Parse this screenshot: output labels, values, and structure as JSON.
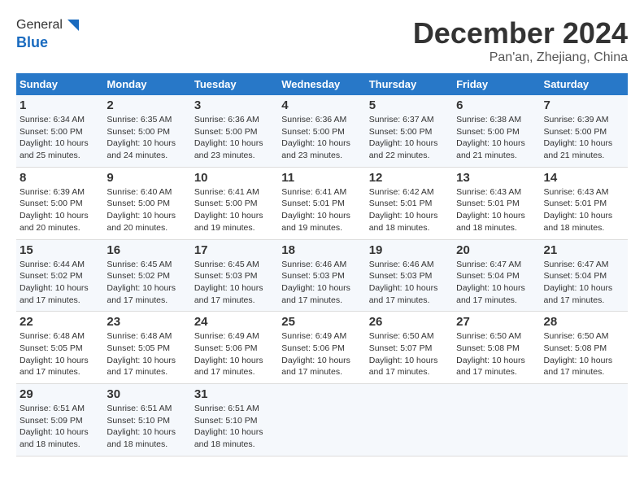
{
  "header": {
    "logo_line1": "General",
    "logo_line2": "Blue",
    "month": "December 2024",
    "location": "Pan'an, Zhejiang, China"
  },
  "days_of_week": [
    "Sunday",
    "Monday",
    "Tuesday",
    "Wednesday",
    "Thursday",
    "Friday",
    "Saturday"
  ],
  "weeks": [
    [
      {
        "day": "1",
        "info": "Sunrise: 6:34 AM\nSunset: 5:00 PM\nDaylight: 10 hours\nand 25 minutes."
      },
      {
        "day": "2",
        "info": "Sunrise: 6:35 AM\nSunset: 5:00 PM\nDaylight: 10 hours\nand 24 minutes."
      },
      {
        "day": "3",
        "info": "Sunrise: 6:36 AM\nSunset: 5:00 PM\nDaylight: 10 hours\nand 23 minutes."
      },
      {
        "day": "4",
        "info": "Sunrise: 6:36 AM\nSunset: 5:00 PM\nDaylight: 10 hours\nand 23 minutes."
      },
      {
        "day": "5",
        "info": "Sunrise: 6:37 AM\nSunset: 5:00 PM\nDaylight: 10 hours\nand 22 minutes."
      },
      {
        "day": "6",
        "info": "Sunrise: 6:38 AM\nSunset: 5:00 PM\nDaylight: 10 hours\nand 21 minutes."
      },
      {
        "day": "7",
        "info": "Sunrise: 6:39 AM\nSunset: 5:00 PM\nDaylight: 10 hours\nand 21 minutes."
      }
    ],
    [
      {
        "day": "8",
        "info": "Sunrise: 6:39 AM\nSunset: 5:00 PM\nDaylight: 10 hours\nand 20 minutes."
      },
      {
        "day": "9",
        "info": "Sunrise: 6:40 AM\nSunset: 5:00 PM\nDaylight: 10 hours\nand 20 minutes."
      },
      {
        "day": "10",
        "info": "Sunrise: 6:41 AM\nSunset: 5:00 PM\nDaylight: 10 hours\nand 19 minutes."
      },
      {
        "day": "11",
        "info": "Sunrise: 6:41 AM\nSunset: 5:01 PM\nDaylight: 10 hours\nand 19 minutes."
      },
      {
        "day": "12",
        "info": "Sunrise: 6:42 AM\nSunset: 5:01 PM\nDaylight: 10 hours\nand 18 minutes."
      },
      {
        "day": "13",
        "info": "Sunrise: 6:43 AM\nSunset: 5:01 PM\nDaylight: 10 hours\nand 18 minutes."
      },
      {
        "day": "14",
        "info": "Sunrise: 6:43 AM\nSunset: 5:01 PM\nDaylight: 10 hours\nand 18 minutes."
      }
    ],
    [
      {
        "day": "15",
        "info": "Sunrise: 6:44 AM\nSunset: 5:02 PM\nDaylight: 10 hours\nand 17 minutes."
      },
      {
        "day": "16",
        "info": "Sunrise: 6:45 AM\nSunset: 5:02 PM\nDaylight: 10 hours\nand 17 minutes."
      },
      {
        "day": "17",
        "info": "Sunrise: 6:45 AM\nSunset: 5:03 PM\nDaylight: 10 hours\nand 17 minutes."
      },
      {
        "day": "18",
        "info": "Sunrise: 6:46 AM\nSunset: 5:03 PM\nDaylight: 10 hours\nand 17 minutes."
      },
      {
        "day": "19",
        "info": "Sunrise: 6:46 AM\nSunset: 5:03 PM\nDaylight: 10 hours\nand 17 minutes."
      },
      {
        "day": "20",
        "info": "Sunrise: 6:47 AM\nSunset: 5:04 PM\nDaylight: 10 hours\nand 17 minutes."
      },
      {
        "day": "21",
        "info": "Sunrise: 6:47 AM\nSunset: 5:04 PM\nDaylight: 10 hours\nand 17 minutes."
      }
    ],
    [
      {
        "day": "22",
        "info": "Sunrise: 6:48 AM\nSunset: 5:05 PM\nDaylight: 10 hours\nand 17 minutes."
      },
      {
        "day": "23",
        "info": "Sunrise: 6:48 AM\nSunset: 5:05 PM\nDaylight: 10 hours\nand 17 minutes."
      },
      {
        "day": "24",
        "info": "Sunrise: 6:49 AM\nSunset: 5:06 PM\nDaylight: 10 hours\nand 17 minutes."
      },
      {
        "day": "25",
        "info": "Sunrise: 6:49 AM\nSunset: 5:06 PM\nDaylight: 10 hours\nand 17 minutes."
      },
      {
        "day": "26",
        "info": "Sunrise: 6:50 AM\nSunset: 5:07 PM\nDaylight: 10 hours\nand 17 minutes."
      },
      {
        "day": "27",
        "info": "Sunrise: 6:50 AM\nSunset: 5:08 PM\nDaylight: 10 hours\nand 17 minutes."
      },
      {
        "day": "28",
        "info": "Sunrise: 6:50 AM\nSunset: 5:08 PM\nDaylight: 10 hours\nand 17 minutes."
      }
    ],
    [
      {
        "day": "29",
        "info": "Sunrise: 6:51 AM\nSunset: 5:09 PM\nDaylight: 10 hours\nand 18 minutes."
      },
      {
        "day": "30",
        "info": "Sunrise: 6:51 AM\nSunset: 5:10 PM\nDaylight: 10 hours\nand 18 minutes."
      },
      {
        "day": "31",
        "info": "Sunrise: 6:51 AM\nSunset: 5:10 PM\nDaylight: 10 hours\nand 18 minutes."
      },
      {
        "day": "",
        "info": ""
      },
      {
        "day": "",
        "info": ""
      },
      {
        "day": "",
        "info": ""
      },
      {
        "day": "",
        "info": ""
      }
    ]
  ]
}
